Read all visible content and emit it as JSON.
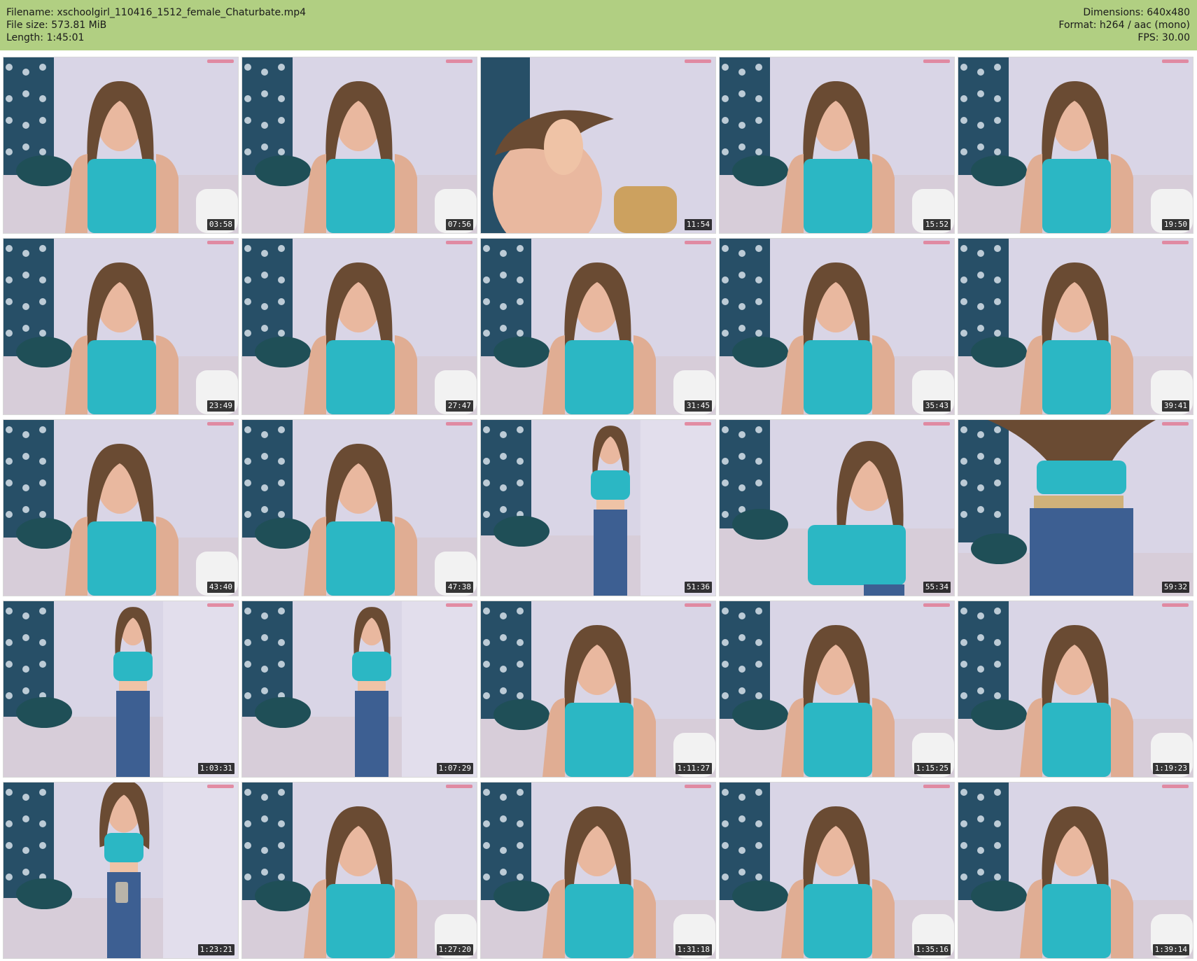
{
  "header": {
    "filename_label": "Filename:",
    "filename": "xschoolgirl_110416_1512_female_Chaturbate.mp4",
    "filesize_label": "File size:",
    "filesize": "573.81 MiB",
    "length_label": "Length:",
    "length": "1:45:01",
    "dimensions_label": "Dimensions:",
    "dimensions": "640x480",
    "format_label": "Format:",
    "format": "h264 / aac (mono)",
    "fps_label": "FPS:",
    "fps": "30.00"
  },
  "colors": {
    "header_bg": "#b1cf82",
    "wall": "#d9d5e6",
    "curtain": "#274f67",
    "bed": "#d7cdd9",
    "pillow": "#1f4f57",
    "top": "#2bb7c4",
    "hair": "#6a4b33",
    "skin": "#e9b89f",
    "jeans": "#3d5f92"
  },
  "thumbnails": [
    {
      "time": "03:58",
      "scene": "close"
    },
    {
      "time": "07:56",
      "scene": "close"
    },
    {
      "time": "11:54",
      "scene": "face-close"
    },
    {
      "time": "15:52",
      "scene": "close"
    },
    {
      "time": "19:50",
      "scene": "close"
    },
    {
      "time": "23:49",
      "scene": "close"
    },
    {
      "time": "27:47",
      "scene": "close"
    },
    {
      "time": "31:45",
      "scene": "close"
    },
    {
      "time": "35:43",
      "scene": "close"
    },
    {
      "time": "39:41",
      "scene": "close"
    },
    {
      "time": "43:40",
      "scene": "close"
    },
    {
      "time": "47:38",
      "scene": "close"
    },
    {
      "time": "51:36",
      "scene": "standing"
    },
    {
      "time": "55:34",
      "scene": "leaning"
    },
    {
      "time": "59:32",
      "scene": "bending"
    },
    {
      "time": "1:03:31",
      "scene": "standing"
    },
    {
      "time": "1:07:29",
      "scene": "standing-back"
    },
    {
      "time": "1:11:27",
      "scene": "close"
    },
    {
      "time": "1:15:25",
      "scene": "close"
    },
    {
      "time": "1:19:23",
      "scene": "close"
    },
    {
      "time": "1:23:21",
      "scene": "phone"
    },
    {
      "time": "1:27:20",
      "scene": "close"
    },
    {
      "time": "1:31:18",
      "scene": "close"
    },
    {
      "time": "1:35:16",
      "scene": "close"
    },
    {
      "time": "1:39:14",
      "scene": "close"
    }
  ]
}
